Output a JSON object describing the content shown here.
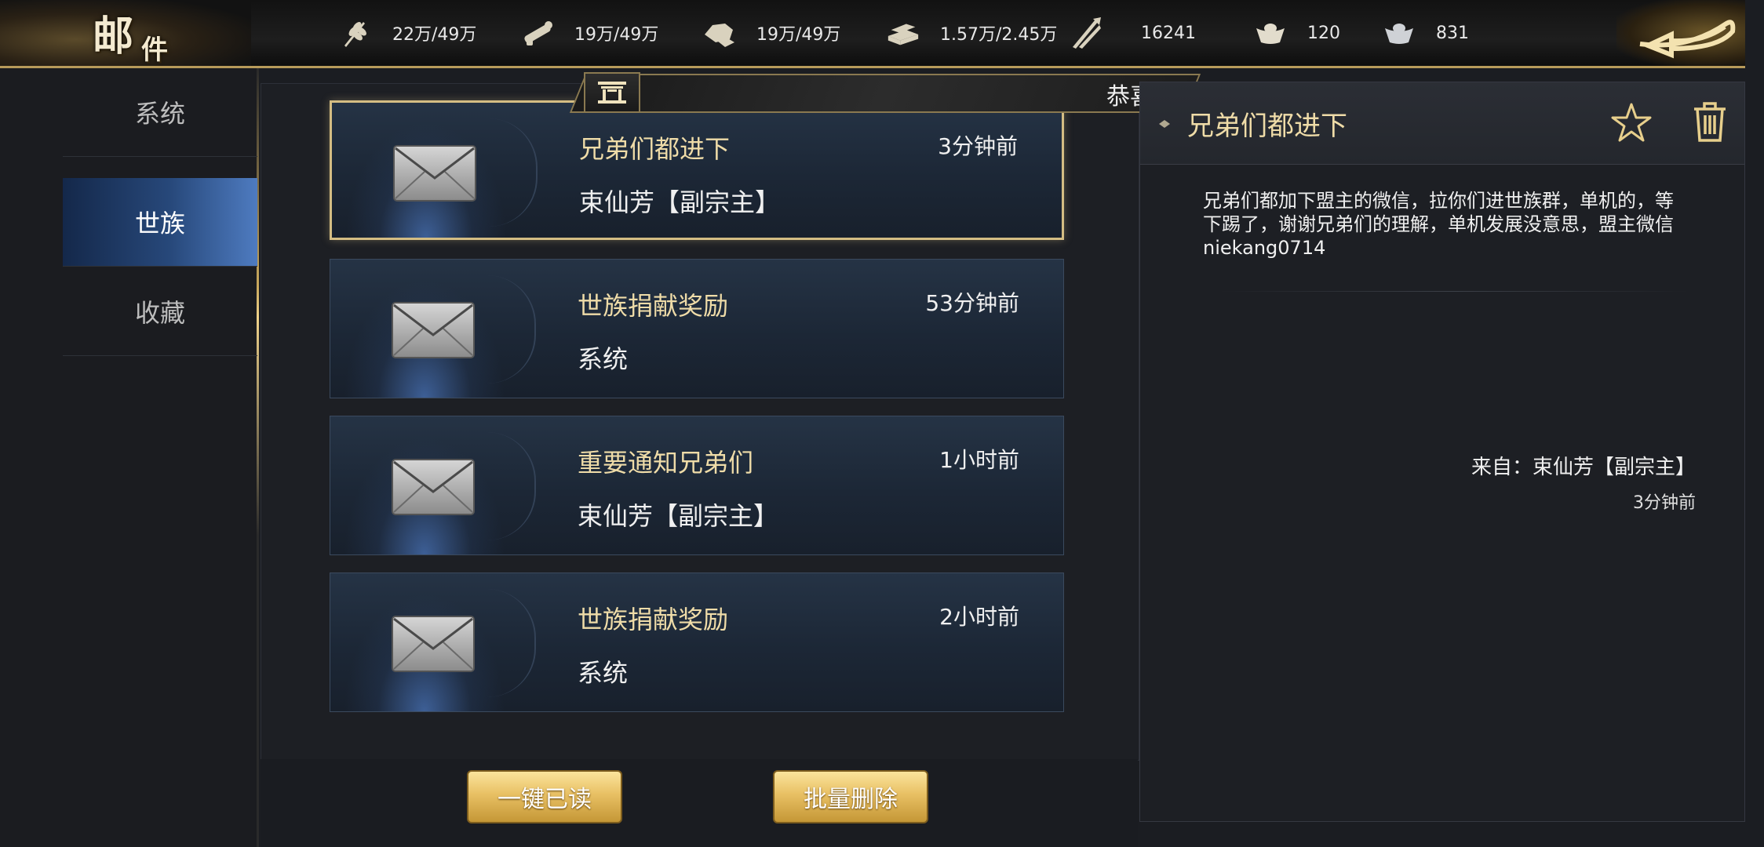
{
  "header": {
    "title_char1": "邮",
    "title_char2": "件",
    "resources": [
      {
        "icon": "wheat-icon",
        "value": "22万/49万"
      },
      {
        "icon": "wood-log-icon",
        "value": "19万/49万"
      },
      {
        "icon": "stone-icon",
        "value": "19万/49万"
      },
      {
        "icon": "iron-ingot-icon",
        "value": "1.57万/2.45万"
      },
      {
        "icon": "spear-icon",
        "value": "16241"
      },
      {
        "icon": "gold-ingot-icon",
        "value": "120"
      },
      {
        "icon": "silver-ingot-icon",
        "value": "831"
      }
    ]
  },
  "nav": {
    "tabs": [
      {
        "label": "系统",
        "active": false
      },
      {
        "label": "世族",
        "active": true
      },
      {
        "label": "收藏",
        "active": false
      }
    ]
  },
  "banner": {
    "label": "恭喜"
  },
  "mails": [
    {
      "subject": "兄弟们都进下",
      "sender": "束仙芳【副宗主】",
      "time": "3分钟前",
      "selected": true
    },
    {
      "subject": "世族捐献奖励",
      "sender": "系统",
      "time": "53分钟前",
      "selected": false
    },
    {
      "subject": "重要通知兄弟们",
      "sender": "束仙芳【副宗主】",
      "time": "1小时前",
      "selected": false
    },
    {
      "subject": "世族捐献奖励",
      "sender": "系统",
      "time": "2小时前",
      "selected": false
    }
  ],
  "actions": {
    "mark_all_read": "一键已读",
    "batch_delete": "批量删除"
  },
  "detail": {
    "title": "兄弟们都进下",
    "body": "兄弟们都加下盟主的微信，拉你们进世族群，单机的，等下踢了，谢谢兄弟们的理解，单机发展没意思，盟主微信niekang0714",
    "from": "来自：束仙芳【副宗主】",
    "time": "3分钟前"
  },
  "colors": {
    "accent_gold": "#d4bd83",
    "active_tab_blue": "#4e7bc0",
    "subject_text": "#efdca8"
  }
}
